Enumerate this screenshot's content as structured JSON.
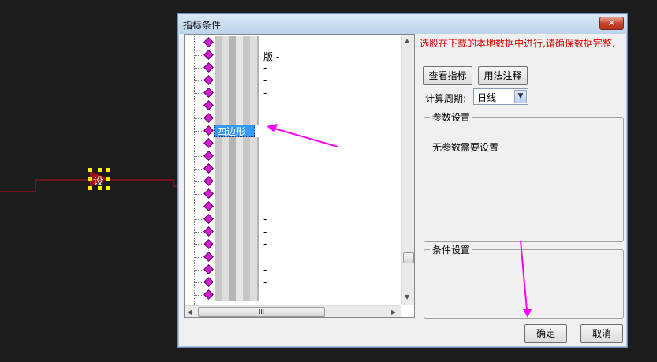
{
  "dialog": {
    "title": "指标条件",
    "close": "✕"
  },
  "tree": {
    "items": [
      {
        "suffix": ""
      },
      {
        "suffix": "版 -"
      },
      {
        "suffix": "-"
      },
      {
        "suffix": "-"
      },
      {
        "suffix": "-"
      },
      {
        "suffix": "-"
      },
      {
        "suffix": ""
      },
      {
        "label": "四边形 -",
        "selected": true
      },
      {
        "suffix": "-"
      },
      {
        "suffix": ""
      },
      {
        "suffix": ""
      },
      {
        "suffix": ""
      },
      {
        "suffix": ""
      },
      {
        "suffix": ""
      },
      {
        "suffix": "-"
      },
      {
        "suffix": "-"
      },
      {
        "suffix": "-"
      },
      {
        "suffix": ""
      },
      {
        "suffix": "-"
      },
      {
        "suffix": "-"
      },
      {
        "suffix": ""
      }
    ],
    "hscroll_grip": "III"
  },
  "notice": "选股在下载的本地数据中进行,请确保数据完整.",
  "buttons": {
    "view_indicator": "查看指标",
    "usage_notes": "用法注释",
    "ok": "确定",
    "cancel": "取消"
  },
  "period": {
    "label": "计算周期:",
    "value": "日线"
  },
  "params": {
    "title": "参数设置",
    "message": "无参数需要设置"
  },
  "conditions": {
    "title": "条件设置"
  },
  "canvas": {
    "device_label": "设"
  },
  "colors": {
    "notice": "#e00000",
    "selection": "#3399ff",
    "annotation": "#ff00ff"
  }
}
